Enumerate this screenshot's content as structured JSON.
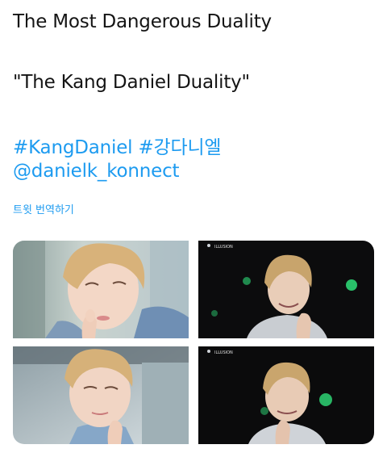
{
  "tweet": {
    "line1": "The Most Dangerous Duality",
    "line2": "\"The Kang Daniel Duality\"",
    "hashtag1": "#KangDaniel",
    "hashtag2": "#강다니엘",
    "mention": "@danielk_konnect",
    "translate_label": "트윗 번역하기"
  },
  "media": {
    "stage_caption": "ILLUSION"
  },
  "colors": {
    "link": "#1d9bf0",
    "text": "#141414",
    "stage_light": "#2fe07a"
  }
}
